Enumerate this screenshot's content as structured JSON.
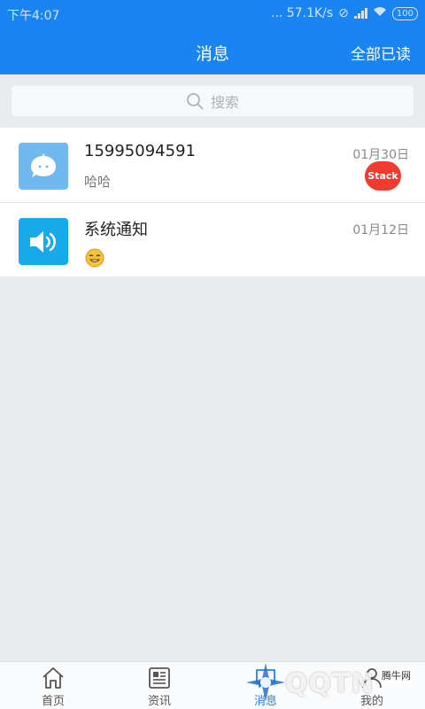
{
  "status_bar": {
    "time": "下午4:07",
    "network_speed": "... 57.1K/s",
    "battery": "100"
  },
  "header": {
    "title": "消息",
    "read_all": "全部已读"
  },
  "search": {
    "placeholder": "搜索"
  },
  "conversations": [
    {
      "name": "15995094591",
      "preview": "哈哈",
      "date": "01月30日",
      "badge": "Stack",
      "avatar_color": "#6fb8f0",
      "icon": "chat-bubble-icon"
    },
    {
      "name": "系统通知",
      "preview": "",
      "date": "01月12日",
      "avatar_color": "#17a9ea",
      "icon": "speaker-icon"
    }
  ],
  "tabs": [
    {
      "label": "首页",
      "icon": "home-icon"
    },
    {
      "label": "资讯",
      "icon": "news-icon"
    },
    {
      "label": "消息",
      "icon": "message-icon",
      "active": true
    },
    {
      "label": "我的",
      "icon": "profile-icon"
    }
  ],
  "watermark": {
    "text": "QQTN",
    "small": "腾牛网"
  },
  "colors": {
    "primary": "#1a84f2",
    "badge": "#ef3b30",
    "background": "#e9ebef"
  }
}
